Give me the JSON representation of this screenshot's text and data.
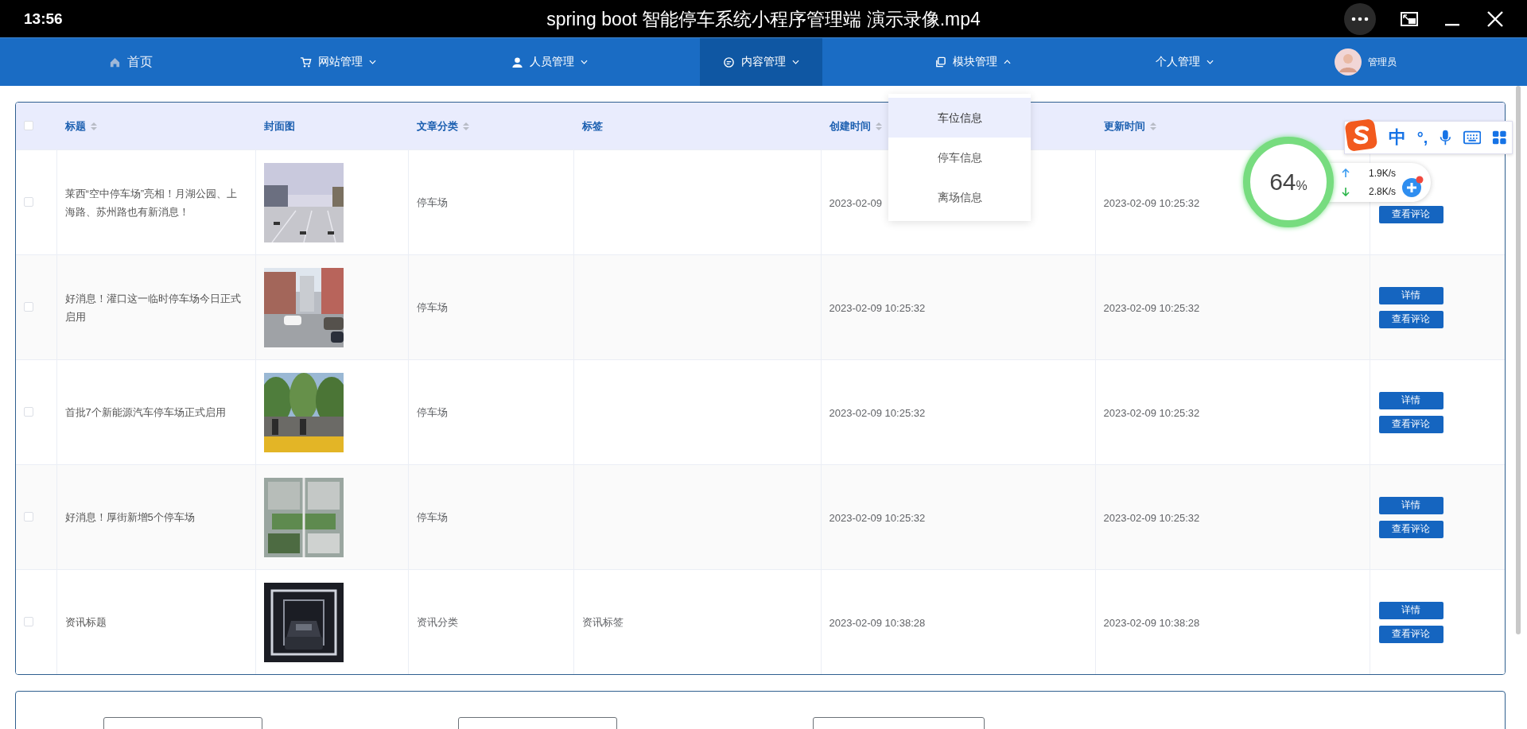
{
  "player": {
    "time": "13:56",
    "title": "spring boot 智能停车系统小程序管理端 演示录像.mp4"
  },
  "nav": {
    "items": [
      {
        "label": "首页",
        "has_menu": false,
        "selected": false,
        "expanded": false
      },
      {
        "label": "网站管理",
        "has_menu": true,
        "selected": false,
        "expanded": false
      },
      {
        "label": "人员管理",
        "has_menu": true,
        "selected": false,
        "expanded": false
      },
      {
        "label": "内容管理",
        "has_menu": true,
        "selected": true,
        "expanded": false
      },
      {
        "label": "模块管理",
        "has_menu": true,
        "selected": false,
        "expanded": true
      },
      {
        "label": "个人管理",
        "has_menu": true,
        "selected": false,
        "expanded": false
      }
    ],
    "user": {
      "name": "管理员"
    }
  },
  "dropdown": {
    "items": [
      {
        "label": "车位信息",
        "selected": true
      },
      {
        "label": "停车信息",
        "selected": false
      },
      {
        "label": "离场信息",
        "selected": false
      }
    ]
  },
  "table": {
    "all_checked": false,
    "columns": [
      {
        "label": "标题",
        "sortable": true
      },
      {
        "label": "封面图",
        "sortable": false
      },
      {
        "label": "文章分类",
        "sortable": true
      },
      {
        "label": "标签",
        "sortable": false
      },
      {
        "label": "创建时间",
        "sortable": true
      },
      {
        "label": "更新时间",
        "sortable": true
      }
    ],
    "rows": [
      {
        "checked": false,
        "title": "莱西“空中停车场”亮相！月湖公园、上海路、苏州路也有新消息！",
        "cover": {
          "kind": "picture"
        },
        "category": "停车场",
        "created": "2023-02-09",
        "updated": "2023-02-09 10:25:32",
        "actions": [
          "查看评论"
        ]
      },
      {
        "checked": false,
        "title": "好消息！灌口这一临时停车场今日正式启用",
        "cover": {
          "kind": "picture"
        },
        "category": "停车场",
        "created": "2023-02-09 10:25:32",
        "updated": "2023-02-09 10:25:32",
        "actions": [
          "详情",
          "查看评论"
        ]
      },
      {
        "checked": false,
        "title": "首批7个新能源汽车停车场正式启用",
        "cover": {
          "kind": "picture"
        },
        "category": "停车场",
        "created": "2023-02-09 10:25:32",
        "updated": "2023-02-09 10:25:32",
        "actions": [
          "详情",
          "查看评论"
        ]
      },
      {
        "checked": false,
        "title": "好消息！厚街新增5个停车场",
        "cover": {
          "kind": "picture"
        },
        "category": "停车场",
        "created": "2023-02-09 10:25:32",
        "updated": "2023-02-09 10:25:32",
        "actions": [
          "详情",
          "查看评论"
        ]
      },
      {
        "checked": false,
        "title": "资讯标题",
        "cover": {
          "kind": "picture"
        },
        "category": "资讯分类",
        "tag": "资讯标签",
        "created": "2023-02-09 10:38:28",
        "updated": "2023-02-09 10:38:28",
        "actions": [
          "详情",
          "查看评论"
        ]
      }
    ]
  },
  "filter_fields": [
    {
      "kind": "text"
    },
    {
      "kind": "text"
    },
    {
      "kind": "wide"
    }
  ],
  "speed_widget": {
    "percent": "64",
    "unit": "%",
    "upload": "1.9K/s",
    "download": "2.8K/s"
  },
  "ime_bar": {
    "mode": "中",
    "punctuation": "°,"
  }
}
